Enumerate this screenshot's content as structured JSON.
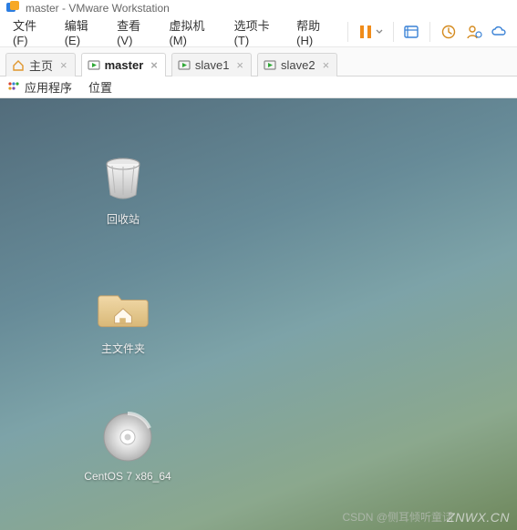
{
  "titlebar": {
    "title": "master - VMware Workstation"
  },
  "menu": {
    "file": "文件(F)",
    "edit": "编辑(E)",
    "view": "查看(V)",
    "vm": "虚拟机(M)",
    "tabs": "选项卡(T)",
    "help": "帮助(H)"
  },
  "tabs": {
    "home": "主页",
    "master": "master",
    "slave1": "slave1",
    "slave2": "slave2"
  },
  "guest_topbar": {
    "applications": "应用程序",
    "places": "位置"
  },
  "desktop": {
    "trash": "回收站",
    "home": "主文件夹",
    "disc_label": "CentOS 7 x86_64"
  },
  "watermark": {
    "csdn": "CSDN @侧耳倾听童话",
    "site": "ZNWX.CN"
  }
}
